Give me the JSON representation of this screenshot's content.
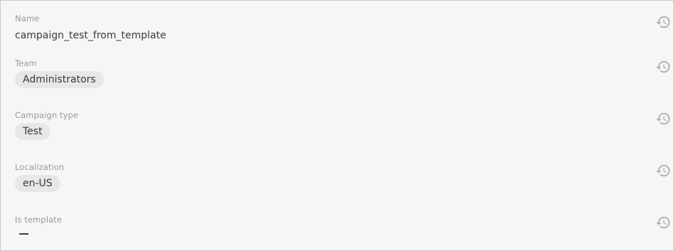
{
  "fields": {
    "name": {
      "label": "Name",
      "value": "campaign_test_from_template"
    },
    "team": {
      "label": "Team",
      "value": "Administrators"
    },
    "campaign_type": {
      "label": "Campaign type",
      "value": "Test"
    },
    "localization": {
      "label": "Localization",
      "value": "en-US"
    },
    "is_template": {
      "label": "Is template",
      "value": "—"
    }
  },
  "icons": {
    "history": "history-icon"
  },
  "colors": {
    "panel_background": "#f6f6f6",
    "chip_background": "#e7e7e7",
    "label_text": "#9a9a9a",
    "value_text": "#3a3a3a",
    "icon": "#b0b0b0"
  }
}
